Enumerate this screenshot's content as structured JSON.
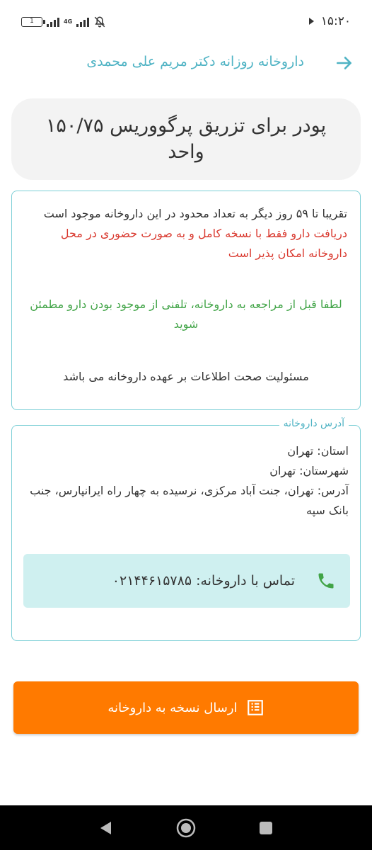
{
  "status_bar": {
    "battery_level": "1",
    "network_type": "4G",
    "time": "۱۵:۲۰"
  },
  "header": {
    "title": "داروخانه روزانه دکتر مریم علی محمدی",
    "back_icon": "arrow-right-icon"
  },
  "product": {
    "title": "پودر برای تزریق پرگووریس ۱۵۰/۷۵ واحد"
  },
  "info": {
    "availability": "تقریبا تا ۵۹ روز دیگر به تعداد محدود در این داروخانه موجود است",
    "warning": "دریافت دارو فقط با نسخه کامل و به صورت حضوری در محل داروخانه امکان پذیر است",
    "call_notice": "لطفا قبل از مراجعه به داروخانه، تلفنی از موجود بودن دارو مطمئن شوید",
    "responsibility": "مسئولیت صحت اطلاعات بر عهده داروخانه می باشد"
  },
  "address": {
    "legend": "آدرس داروخانه",
    "province": "استان: تهران",
    "city": "شهرستان: تهران",
    "street": "آدرس: تهران، جنت آباد مرکزی، نرسیده به چهار راه ایرانپارس، جنب بانک سپه",
    "call_label": "تماس با داروخانه: ۰۲۱۴۴۶۱۵۷۸۵"
  },
  "send_button": {
    "label": "ارسال نسخه به داروخانه"
  },
  "colors": {
    "accent": "#4fb3c4",
    "border": "#7ccfd6",
    "warning": "#d9392f",
    "notice": "#41a447",
    "call_bg": "#cff0f0",
    "primary_button": "#ff7a00"
  }
}
